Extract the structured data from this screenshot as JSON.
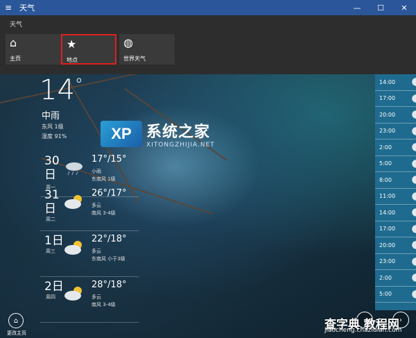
{
  "window": {
    "title": "天气",
    "menu_icon": "hamburger-icon",
    "controls": [
      "minimize-icon",
      "maximize-icon",
      "close-icon"
    ]
  },
  "nav": {
    "app_title": "天气",
    "items": [
      {
        "label": "主页",
        "icon": "home-icon",
        "selected": false
      },
      {
        "label": "地点",
        "icon": "star-icon",
        "selected": true
      },
      {
        "label": "世界天气",
        "icon": "globe-icon",
        "selected": false
      }
    ]
  },
  "current": {
    "temp": "14",
    "deg": "°",
    "condition": "中雨",
    "wind": "东风 1级",
    "humidity": "湿度 91%"
  },
  "watermark": {
    "logo": "XP",
    "title": "系统之家",
    "sub": "XITONGZHIJIA.NET"
  },
  "forecast": [
    {
      "day": "30",
      "unit": "日",
      "weekday": "周一",
      "hilo": "17°/15°",
      "cond": "小雨",
      "wind": "东南风 1级",
      "icon": "rain-icon"
    },
    {
      "day": "31",
      "unit": "日",
      "weekday": "周二",
      "hilo": "26°/17°",
      "cond": "多云",
      "wind": "南风 3-4级",
      "icon": "partly-cloudy-icon"
    },
    {
      "day": "1",
      "unit": "日",
      "weekday": "周三",
      "hilo": "22°/18°",
      "cond": "多云",
      "wind": "东南风 小于3级",
      "icon": "partly-cloudy-icon"
    },
    {
      "day": "2",
      "unit": "日",
      "weekday": "周四",
      "hilo": "28°/18°",
      "cond": "多云",
      "wind": "南风 3-4级",
      "icon": "partly-cloudy-icon"
    }
  ],
  "hourly": [
    "14:00",
    "17:00",
    "20:00",
    "23:00",
    "2:00",
    "5:00",
    "8:00",
    "11:00",
    "14:00",
    "17:00",
    "20:00",
    "23:00",
    "2:00",
    "5:00"
  ],
  "bottom": {
    "home_label": "更改主页",
    "home_icon": "home-icon"
  },
  "watermark2": {
    "title": "查字典 教程网",
    "url": "jiaocheng.chazidian.com"
  }
}
